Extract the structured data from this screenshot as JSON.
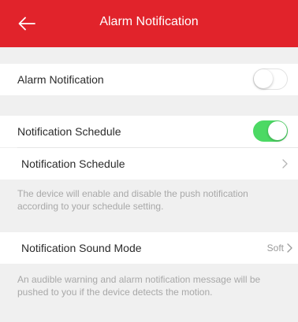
{
  "header": {
    "title": "Alarm Notification",
    "back_icon": "back-arrow-icon",
    "background": "#e1232b"
  },
  "alarm_notification": {
    "label": "Alarm Notification",
    "enabled": false
  },
  "schedule": {
    "toggle_label": "Notification Schedule",
    "enabled": true,
    "toggle_on_color": "#4cd964",
    "link_label": "Notification Schedule",
    "chevron_icon": "chevron-right-icon",
    "note": "The device will enable and disable the push notification according to your schedule setting."
  },
  "sound_mode": {
    "label": "Notification Sound Mode",
    "value": "Soft",
    "chevron_icon": "chevron-right-icon",
    "note": "An audible warning and alarm notification message will be pushed to you if the device detects the motion."
  }
}
